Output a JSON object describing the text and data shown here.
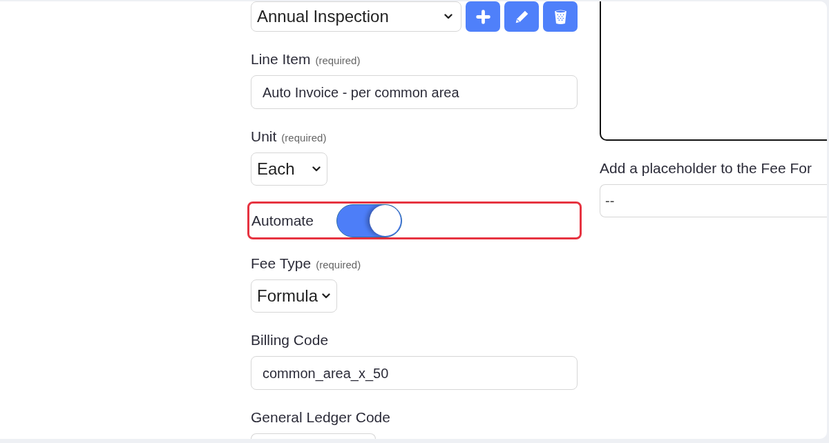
{
  "form": {
    "fields": [
      {
        "kind": "select_with_actions",
        "value": "Annual Inspection",
        "actions": [
          {
            "kind": "add"
          },
          {
            "kind": "edit"
          },
          {
            "kind": "delete"
          }
        ]
      },
      {
        "kind": "text",
        "label": "Line Item",
        "note": "(required)",
        "value": "Auto Invoice - per common area"
      },
      {
        "kind": "select",
        "label": "Unit",
        "note": "(required)",
        "value": "Each"
      },
      {
        "kind": "toggle",
        "label": "Automate",
        "on": true,
        "highlighted": true
      },
      {
        "kind": "select",
        "label": "Fee Type",
        "note": "(required)",
        "value": "Formula"
      },
      {
        "kind": "text",
        "label": "Billing Code",
        "value": "common_area_x_50"
      },
      {
        "kind": "text_cut",
        "label": "General Ledger Code"
      }
    ]
  },
  "side_panel": {
    "placeholder_field": {
      "label": "Add a placeholder to the Fee For",
      "value": "--"
    }
  }
}
